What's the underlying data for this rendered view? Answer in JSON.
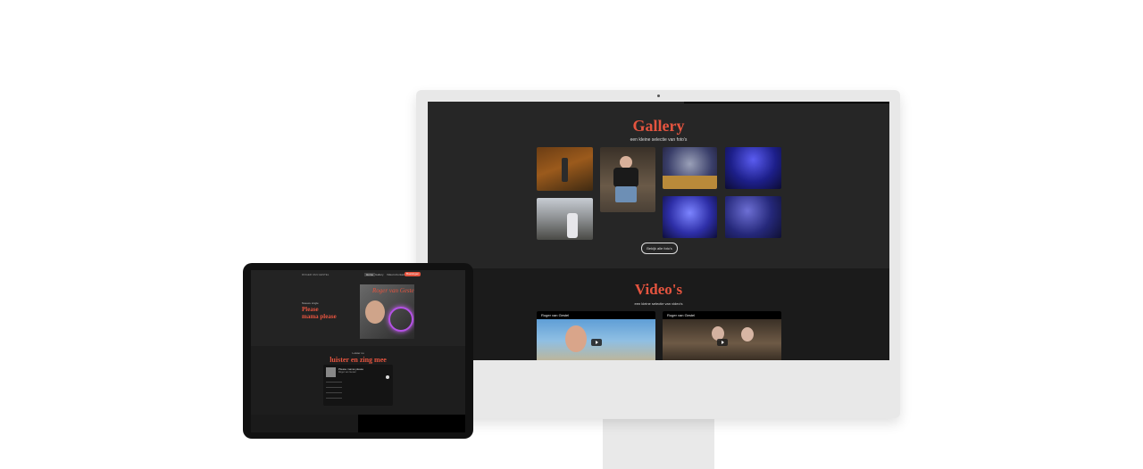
{
  "gallery": {
    "title": "Gallery",
    "subtitle": "een kleine selectie van foto's",
    "more_button": "Bekijk alle foto's"
  },
  "videos": {
    "title": "Video's",
    "subtitle": "een kleine selectie van video's",
    "items": [
      {
        "title": "Roger van Gestel"
      },
      {
        "title": "Roger van Gestel"
      }
    ]
  },
  "tablet": {
    "brand": "ROGER VAN GESTEL",
    "nav": [
      "Home",
      "Gallery",
      "Video's",
      "Contact",
      "Boekingen"
    ],
    "hero_kicker": "Nieuwe single",
    "hero_title_line1": "Please",
    "hero_title_line2": "mama please",
    "cover_script": "Roger van Gestel",
    "listen_kicker": "Luister nu",
    "listen_title": "luister en zing mee",
    "player_track": "Please mama please",
    "player_artist": "Roger van Gestel"
  },
  "colors": {
    "accent": "#e5543f",
    "bg_dark": "#262626"
  }
}
